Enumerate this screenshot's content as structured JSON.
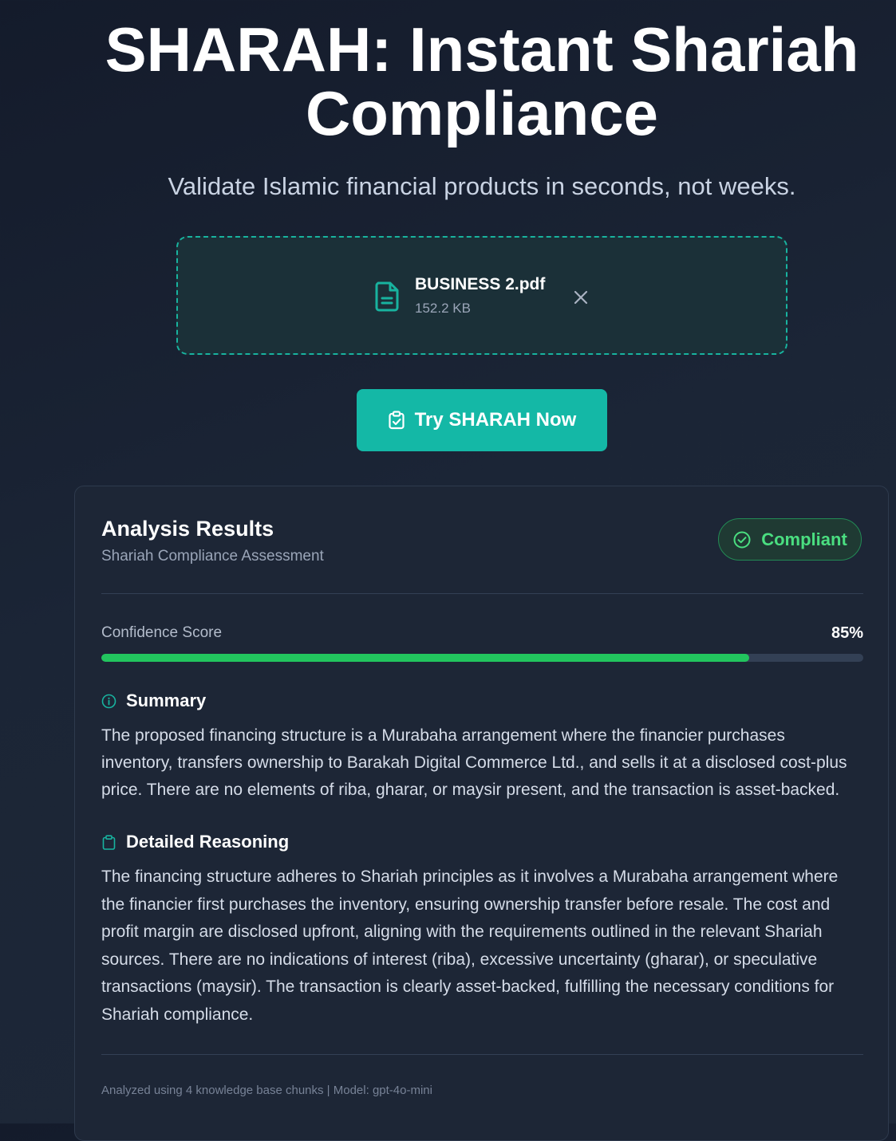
{
  "hero": {
    "title": "SHARAH: Instant Shariah Compliance",
    "subtitle": "Validate Islamic financial products in seconds, not weeks."
  },
  "upload": {
    "file_name": "BUSINESS 2.pdf",
    "file_size": "152.2 KB",
    "file_icon": "file-text-icon",
    "remove_icon": "close-icon"
  },
  "cta": {
    "label": "Try SHARAH Now",
    "icon": "clipboard-check-icon"
  },
  "results": {
    "title": "Analysis Results",
    "subtitle": "Shariah Compliance Assessment",
    "status": {
      "label": "Compliant",
      "icon": "check-circle-icon",
      "color": "#4ade80"
    },
    "confidence": {
      "label": "Confidence Score",
      "value_text": "85%",
      "value": 0.85,
      "bar_color": "#22c55e"
    },
    "summary": {
      "heading": "Summary",
      "icon": "info-icon",
      "text": "The proposed financing structure is a Murabaha arrangement where the financier purchases inventory, transfers ownership to Barakah Digital Commerce Ltd., and sells it at a disclosed cost-plus price. There are no elements of riba, gharar, or maysir present, and the transaction is asset-backed."
    },
    "reasoning": {
      "heading": "Detailed Reasoning",
      "icon": "clipboard-icon",
      "text": "The financing structure adheres to Shariah principles as it involves a Murabaha arrangement where the financier first purchases the inventory, ensuring ownership transfer before resale. The cost and profit margin are disclosed upfront, aligning with the requirements outlined in the relevant Shariah sources. There are no indications of interest (riba), excessive uncertainty (gharar), or speculative transactions (maysir). The transaction is clearly asset-backed, fulfilling the necessary conditions for Shariah compliance."
    },
    "footer": "Analyzed using 4 knowledge base chunks | Model: gpt-4o-mini"
  },
  "colors": {
    "accent": "#14b8a6",
    "success": "#22c55e",
    "background": "#1b2536"
  }
}
